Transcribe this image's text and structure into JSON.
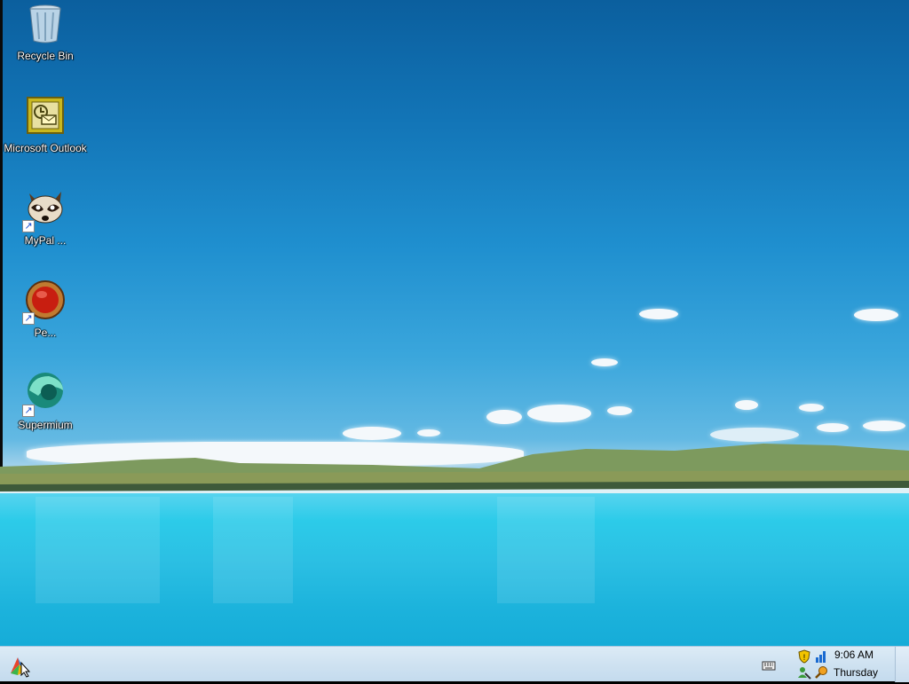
{
  "desktop": {
    "icons": [
      {
        "label": "Recycle Bin",
        "icon": "recycle-bin-icon"
      },
      {
        "label": "Microsoft Outlook",
        "icon": "outlook-icon"
      },
      {
        "label": "MyPal ...",
        "icon": "mypal-raccoon-icon"
      },
      {
        "label": "Pe...",
        "icon": "red-orb-icon"
      },
      {
        "label": "Supermium",
        "icon": "supermium-icon"
      }
    ]
  },
  "taskbar": {
    "start_icon": "windows-start-icon",
    "tray_icons": [
      "keyboard-icon",
      "shield-security-icon",
      "network-icon",
      "user-status-icon",
      "search-key-icon"
    ],
    "clock": {
      "time": "9:06 AM",
      "day": "Thursday"
    }
  },
  "colors": {
    "sky_top": "#0b5f9e",
    "lake": "#2ccbe9",
    "taskbar": "#cfe2f1"
  }
}
